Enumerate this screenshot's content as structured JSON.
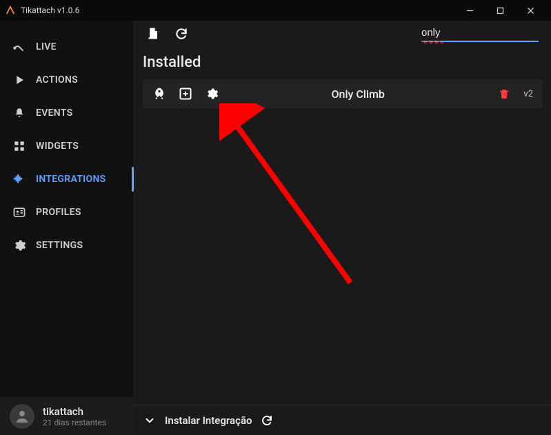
{
  "titlebar": {
    "title": "Tikattach v1.0.6"
  },
  "nav": {
    "items": [
      {
        "label": "LIVE"
      },
      {
        "label": "ACTIONS"
      },
      {
        "label": "EVENTS"
      },
      {
        "label": "WIDGETS"
      },
      {
        "label": "INTEGRATIONS"
      },
      {
        "label": "PROFILES"
      },
      {
        "label": "SETTINGS"
      }
    ]
  },
  "user": {
    "name": "tikattach",
    "status": "21 dias restantes"
  },
  "search": {
    "value": "only"
  },
  "section": {
    "title": "Installed"
  },
  "integration": {
    "name": "Only Climb",
    "version": "v2"
  },
  "footer": {
    "label": "Instalar Integração"
  }
}
